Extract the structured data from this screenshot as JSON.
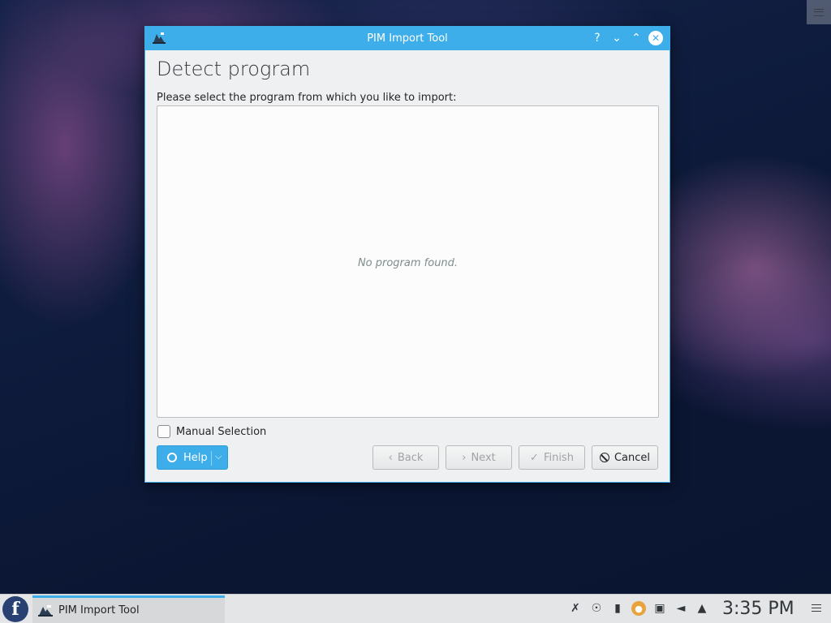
{
  "window": {
    "title": "PIM Import Tool"
  },
  "page": {
    "title": "Detect program",
    "prompt": "Please select the program from which you like to import:",
    "empty_message": "No program found."
  },
  "manual_selection": {
    "label": "Manual Selection",
    "checked": false
  },
  "buttons": {
    "help": "Help",
    "back": "Back",
    "next": "Next",
    "finish": "Finish",
    "cancel": "Cancel"
  },
  "taskbar": {
    "task_label": "PIM Import Tool",
    "clock": "3:35 PM",
    "tray_icons": [
      "network-disconnected-icon",
      "rss-icon",
      "clipboard-icon",
      "updater-icon",
      "display-icon",
      "volume-muted-icon",
      "tray-expand-icon"
    ]
  },
  "colors": {
    "accent": "#3daee9",
    "window_bg": "#eff0f1",
    "taskbar_bg": "#e3e5e7"
  }
}
